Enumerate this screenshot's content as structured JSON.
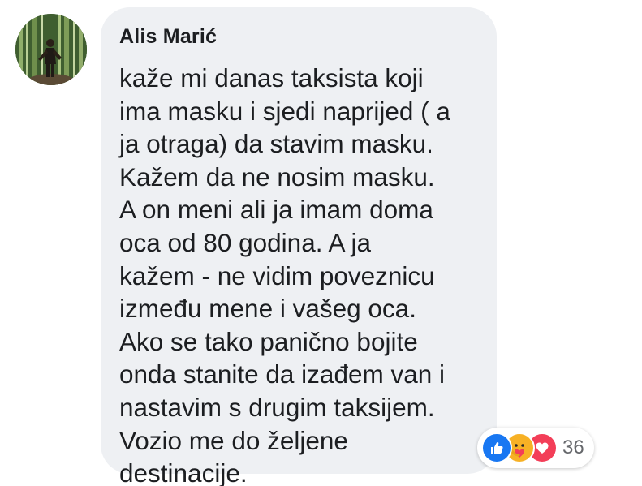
{
  "comment": {
    "author": "Alis Marić",
    "text_lines": [
      "kaže mi danas taksista koji",
      "ima masku i sjedi naprijed ( a",
      "ja otraga) da stavim masku.",
      "Kažem da ne nosim masku.",
      "A on meni ali ja imam doma",
      "oca od 80 godina. A ja",
      "kažem - ne vidim poveznicu",
      "između mene i vašeg oca.",
      "Ako se tako panično bojite",
      "onda stanite da izađem van i",
      "nastavim s drugim taksijem.",
      "Vozio me do željene",
      "destinacije."
    ]
  },
  "reactions": {
    "icons": [
      "like-icon",
      "care-icon",
      "love-icon"
    ],
    "count": "36"
  },
  "colors": {
    "bubble": "#eef0f3",
    "text": "#1c1e21",
    "like": "#1877f2",
    "care": "#f7b125",
    "love": "#f33e58",
    "count": "#65676b"
  }
}
